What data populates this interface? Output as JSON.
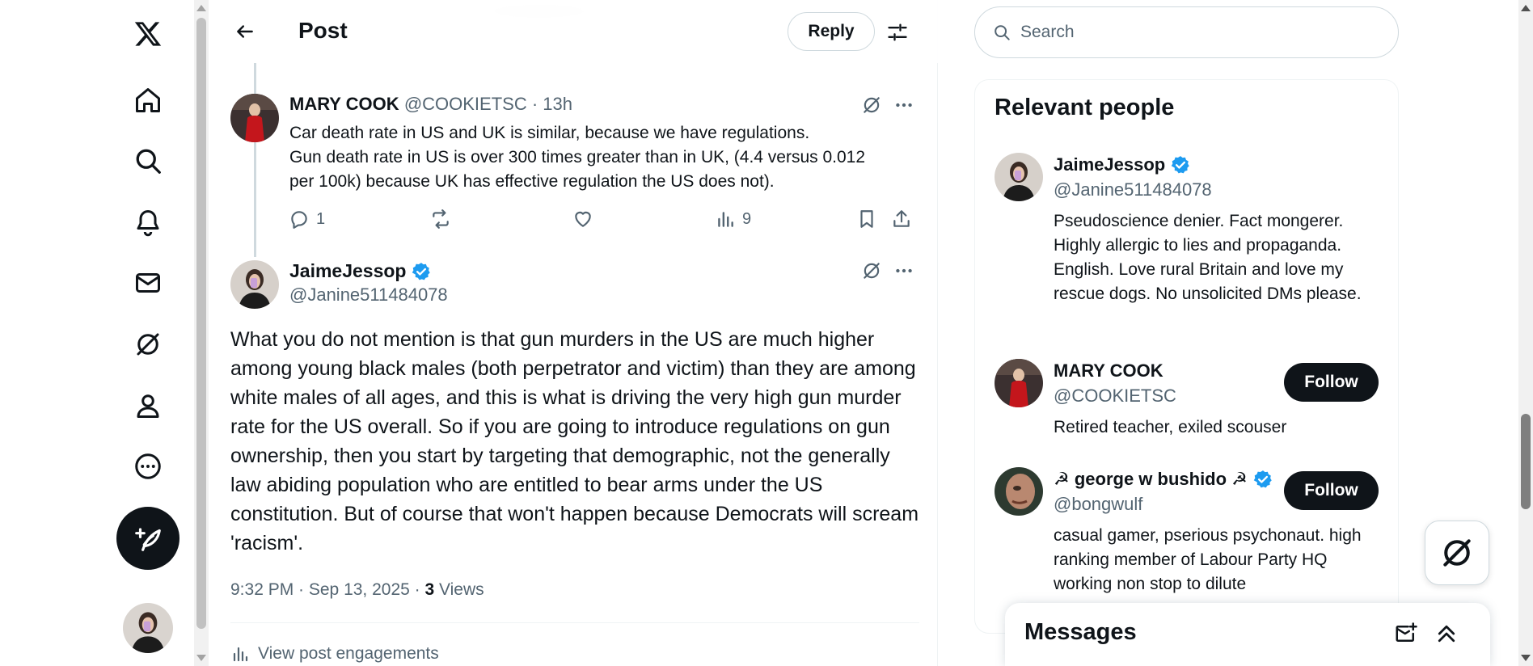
{
  "header": {
    "title": "Post",
    "reply_label": "Reply"
  },
  "reply_post": {
    "name": "MARY COOK",
    "handle": "@COOKIETSC",
    "time": "13h",
    "lines": [
      "Car death rate in US and UK is similar, because we have regulations.",
      "Gun death rate in US is over 300 times greater than in UK, (4.4 versus 0.012",
      "per 100k) because UK has effective regulation the US does not)."
    ],
    "replies": "1",
    "views": "9"
  },
  "main_post": {
    "name": "JaimeJessop",
    "handle": "@Janine511484078",
    "text": "What you do not mention is that gun murders in the US are much higher among young black males (both perpetrator and victim) than they are among white males of all ages, and this is what is driving the very high gun murder rate for the US overall. So if you are going to introduce regulations on gun ownership, then you start by targeting that demographic, not the generally law abiding population who are entitled to bear arms under the US constitution. But of course that won't happen because Democrats will scream 'racism'.",
    "timestamp": "9:32 PM · Sep 13, 2025 · ",
    "views_count": "3",
    "views_label": " Views",
    "engagements_label": "View post engagements"
  },
  "search": {
    "placeholder": "Search"
  },
  "relevant": {
    "title": "Relevant people",
    "people": [
      {
        "name": "JaimeJessop",
        "handle": "@Janine511484078",
        "bio": "Pseudoscience denier. Fact mongerer. Highly allergic to lies and propaganda. English. Love rural Britain and love my rescue dogs. No unsolicited DMs please.",
        "follow": ""
      },
      {
        "name": "MARY COOK",
        "handle": "@COOKIETSC",
        "bio": "Retired teacher, exiled scouser",
        "follow": "Follow"
      },
      {
        "name": "☭ george w bushido ☭",
        "handle": "@bongwulf",
        "bio": "casual gamer, pserious psychonaut. high ranking member of Labour Party HQ working non stop to dilute",
        "follow": "Follow"
      }
    ]
  },
  "messages": {
    "title": "Messages"
  },
  "colors": {
    "verified": "#1d9bf0",
    "text": "#0f1419",
    "secondary": "#536471",
    "border": "#cfd9de"
  },
  "icons": [
    "x-logo-icon",
    "home-icon",
    "search-icon",
    "bell-icon",
    "mail-icon",
    "grok-icon",
    "profile-icon",
    "more-icon",
    "compose-icon",
    "back-arrow-icon",
    "adjust-icon",
    "reply-icon",
    "repost-icon",
    "like-icon",
    "views-icon",
    "bookmark-icon",
    "share-icon",
    "verified-icon",
    "new-message-icon",
    "collapse-icon"
  ]
}
